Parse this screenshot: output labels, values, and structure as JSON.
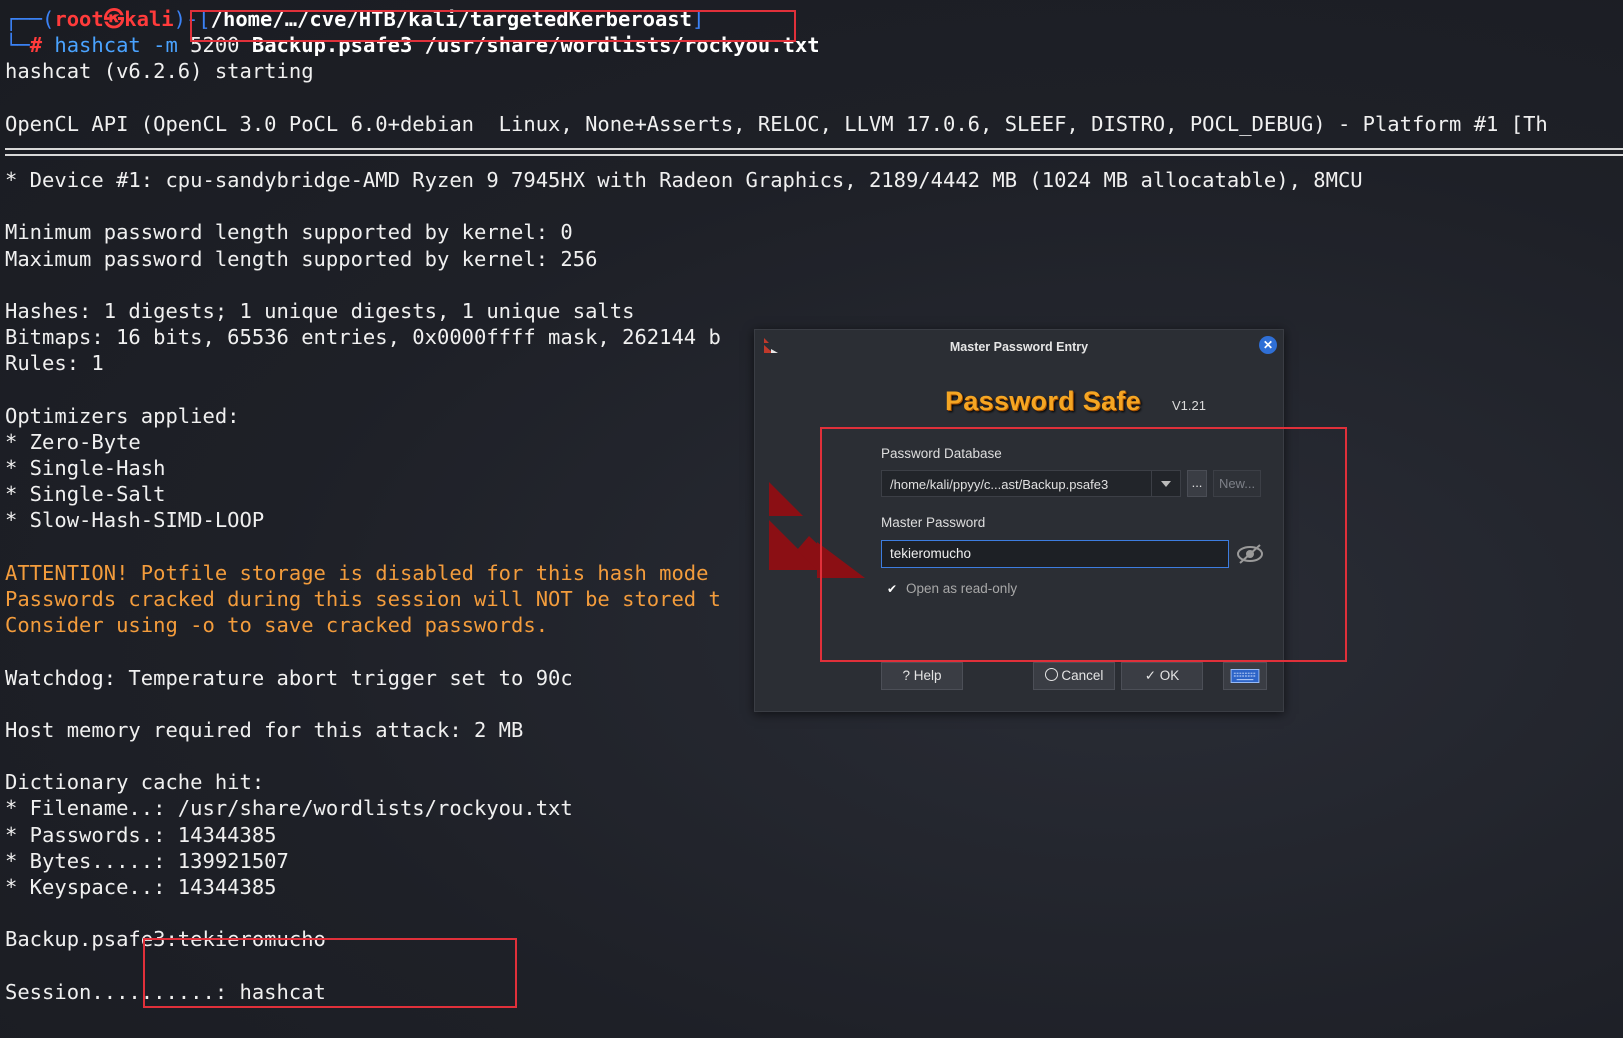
{
  "prompt": {
    "user": "root",
    "host": "kali",
    "at_symbol": "㉿",
    "path": "/home/…/cve/HTB/kali/targetedKerberoast",
    "hash_symbol": "#"
  },
  "command": {
    "program": "hashcat",
    "flag": "-m",
    "mode": "5200",
    "file": "Backup.psafe3",
    "wordlist": "/usr/share/wordlists/rockyou.txt"
  },
  "terminal": {
    "starting": "hashcat (v6.2.6) starting",
    "opencl": "OpenCL API (OpenCL 3.0 PoCL 6.0+debian  Linux, None+Asserts, RELOC, LLVM 17.0.6, SLEEF, DISTRO, POCL_DEBUG) - Platform #1 [Th",
    "device": "* Device #1: cpu-sandybridge-AMD Ryzen 9 7945HX with Radeon Graphics, 2189/4442 MB (1024 MB allocatable), 8MCU",
    "min_len": "Minimum password length supported by kernel: 0",
    "max_len": "Maximum password length supported by kernel: 256",
    "hashes": "Hashes: 1 digests; 1 unique digests, 1 unique salts",
    "bitmaps": "Bitmaps: 16 bits, 65536 entries, 0x0000ffff mask, 262144 b",
    "rules": "Rules: 1",
    "optimizers": "Optimizers applied:",
    "opt1": "* Zero-Byte",
    "opt2": "* Single-Hash",
    "opt3": "* Single-Salt",
    "opt4": "* Slow-Hash-SIMD-LOOP",
    "attn1": "ATTENTION! Potfile storage is disabled for this hash mode",
    "attn2": "Passwords cracked during this session will NOT be stored t",
    "attn3": "Consider using -o to save cracked passwords.",
    "watchdog": "Watchdog: Temperature abort trigger set to 90c",
    "host_mem": "Host memory required for this attack: 2 MB",
    "dict_hit": "Dictionary cache hit:",
    "filename": "* Filename..: /usr/share/wordlists/rockyou.txt",
    "passwords": "* Passwords.: 14344385",
    "bytes": "* Bytes.....: 139921507",
    "keyspace": "* Keyspace..: 14344385",
    "cracked": "Backup.psafe3:tekieromucho",
    "session": "Session..........: hashcat"
  },
  "dialog": {
    "title": "Master Password Entry",
    "brand": "Password Safe",
    "version": "V1.21",
    "db_label": "Password Database",
    "db_value": "/home/kali/ppyy/c...ast/Backup.psafe3",
    "browse_label": "...",
    "new_label": "New...",
    "pw_label": "Master Password",
    "pw_value": "tekieromucho",
    "readonly_label": "Open as read-only",
    "readonly_checked": true,
    "help_label": "? Help",
    "cancel_label": "Cancel",
    "ok_label": "OK"
  },
  "colors": {
    "highlight": "#e0303a",
    "brand": "#f5a623",
    "prompt_blue": "#3b82f6",
    "prompt_red": "#ff3b3b",
    "warning": "#f39c3c"
  }
}
